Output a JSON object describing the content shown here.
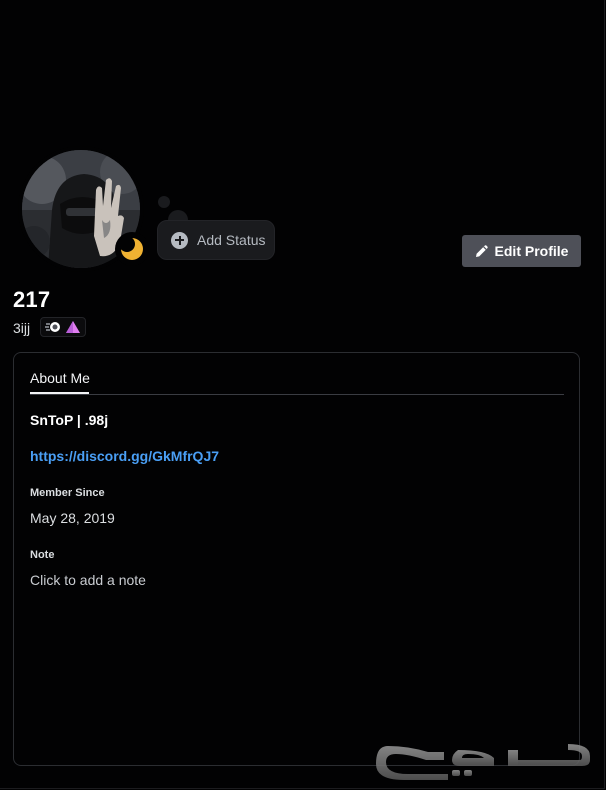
{
  "profile": {
    "display_name": "217",
    "username": "3ijj",
    "status_icon": "moon-idle-icon",
    "badges": [
      "hypesquad-icon",
      "nitro-pyramid-icon"
    ]
  },
  "status": {
    "add_label": "Add Status"
  },
  "actions": {
    "edit_profile_label": "Edit Profile"
  },
  "about": {
    "tab_label": "About Me",
    "bio_line": "SnToP  |  .98j",
    "bio_link": "https://discord.gg/GkMfrQJ7",
    "member_since_heading": "Member Since",
    "member_since_value": "May 28, 2019",
    "note_heading": "Note",
    "note_placeholder": "Click to add a note"
  },
  "watermark": {
    "text": "حراج"
  },
  "colors": {
    "background": "#020203",
    "link": "#4a9ff5",
    "button": "#4e5058",
    "status_idle": "#f0b232"
  }
}
